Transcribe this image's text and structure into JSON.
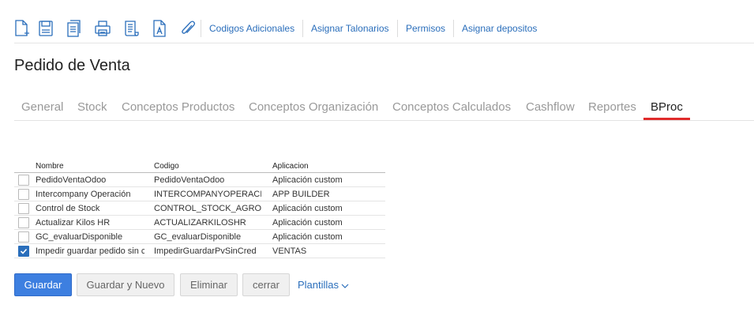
{
  "toolbar": {
    "icons": [
      {
        "name": "new-document-icon"
      },
      {
        "name": "save-icon"
      },
      {
        "name": "copy-icon"
      },
      {
        "name": "print-icon"
      },
      {
        "name": "scroll-icon"
      },
      {
        "name": "font-document-icon"
      },
      {
        "name": "attachment-icon"
      }
    ],
    "links": {
      "codigos": "Codigos Adicionales",
      "talonarios": "Asignar Talonarios",
      "permisos": "Permisos",
      "depositos": "Asignar depositos"
    }
  },
  "page": {
    "title": "Pedido de Venta"
  },
  "tabs": {
    "general": "General",
    "stock": "Stock",
    "conceptos_productos": "Conceptos Productos",
    "conceptos_organizacion": "Conceptos Organización",
    "conceptos_calculados": "Conceptos Calculados",
    "cashflow": "Cashflow",
    "reportes": "Reportes",
    "bproc": "BProc",
    "active": "bproc"
  },
  "table": {
    "headers": {
      "nombre": "Nombre",
      "codigo": "Codigo",
      "aplicacion": "Aplicacion"
    },
    "rows": [
      {
        "nombre": "PedidoVentaOdoo",
        "codigo": "PedidoVentaOdoo",
        "aplicacion": "Aplicación custom",
        "checked": false
      },
      {
        "nombre": "Intercompany Operación",
        "codigo": "INTERCOMPANYOPERACI",
        "aplicacion": "APP BUILDER",
        "checked": false
      },
      {
        "nombre": "Control de Stock",
        "codigo": "CONTROL_STOCK_AGRO",
        "aplicacion": "Aplicación custom",
        "checked": false
      },
      {
        "nombre": "Actualizar Kilos HR",
        "codigo": "ACTUALIZARKILOSHR",
        "aplicacion": "Aplicación custom",
        "checked": false
      },
      {
        "nombre": "GC_evaluarDisponible",
        "codigo": "GC_evaluarDisponible",
        "aplicacion": "Aplicación custom",
        "checked": false
      },
      {
        "nombre": "Impedir guardar pedido sin c",
        "codigo": "ImpedirGuardarPvSinCred",
        "aplicacion": "VENTAS",
        "checked": true
      }
    ]
  },
  "actions": {
    "guardar": "Guardar",
    "guardar_nuevo": "Guardar y Nuevo",
    "eliminar": "Eliminar",
    "cerrar": "cerrar",
    "plantillas": "Plantillas"
  },
  "colors": {
    "accent": "#3d7fe0",
    "link": "#2a6ebb",
    "active_tab_underline": "#e02b2b"
  }
}
